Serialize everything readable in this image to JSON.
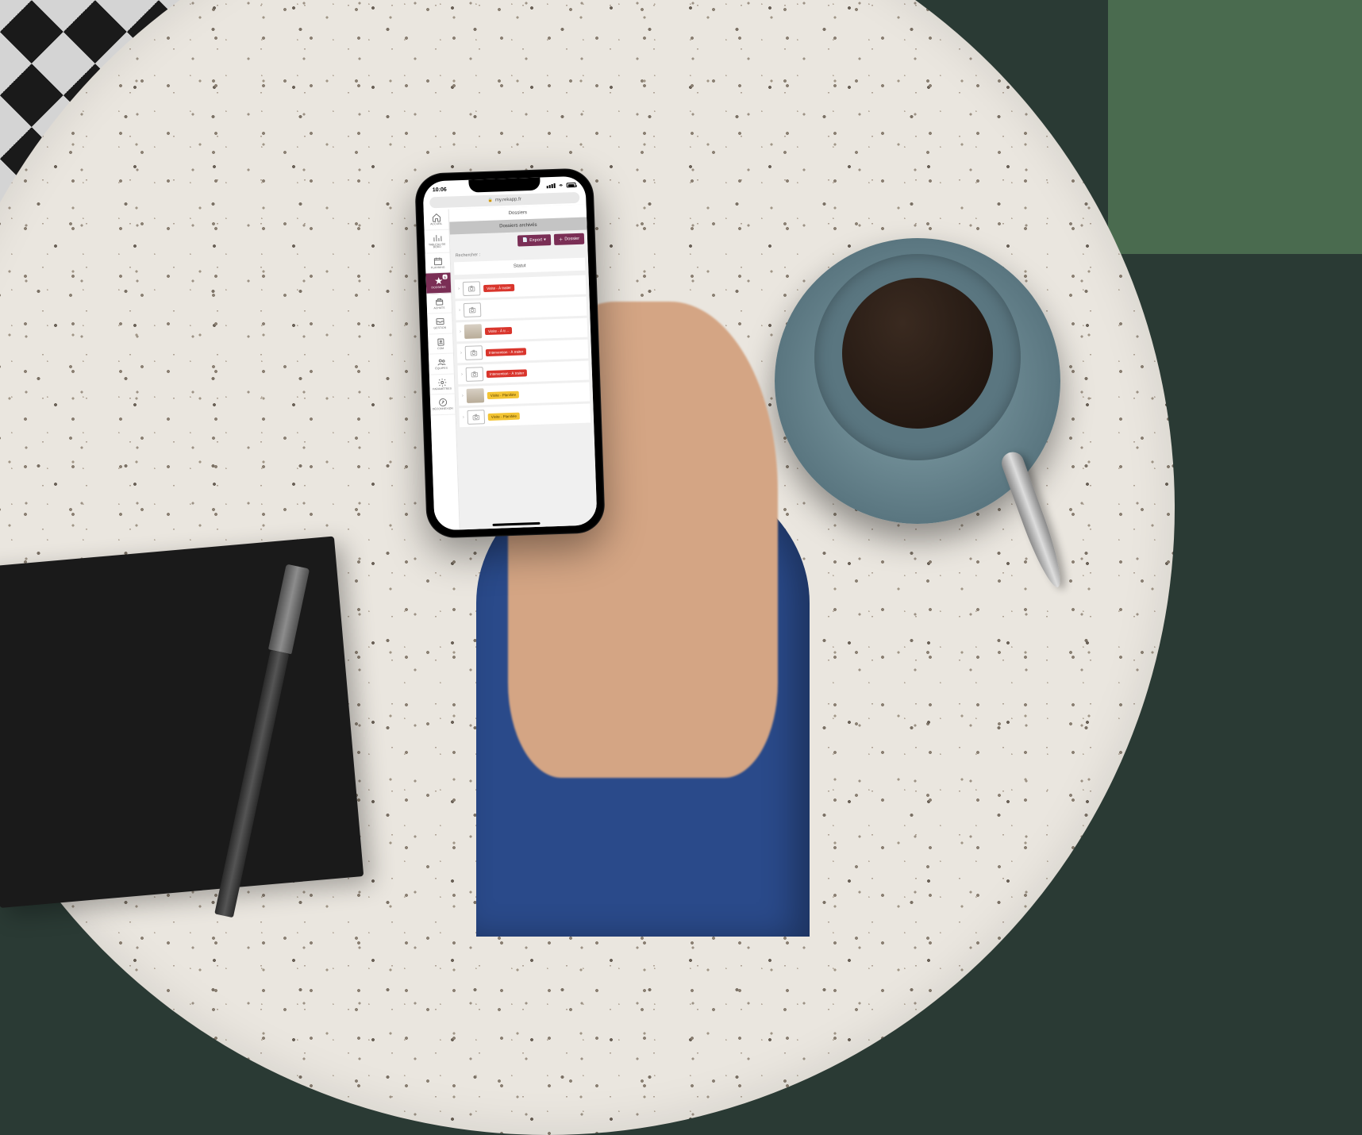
{
  "status_bar": {
    "time": "10:06"
  },
  "url": "my.rekapp.fr",
  "sidebar": {
    "badge": "5",
    "items": [
      {
        "label": "ACCUEIL"
      },
      {
        "label": "TABLEAU DE BORD"
      },
      {
        "label": "PLANNING"
      },
      {
        "label": "DOSSIERS"
      },
      {
        "label": "ACHATS"
      },
      {
        "label": "GESTION"
      },
      {
        "label": "COM"
      },
      {
        "label": "ÉQUIPES"
      },
      {
        "label": "PARAMÈTRES"
      },
      {
        "label": "DÉCONNEXION"
      }
    ]
  },
  "tabs": {
    "dossiers": "Dossiers",
    "archives": "Dossiers archivés"
  },
  "buttons": {
    "export": "Export",
    "dossier": "Dossier"
  },
  "search": {
    "label": "Rechercher :"
  },
  "column": {
    "statut": "Statut"
  },
  "rows": [
    {
      "status": "Visite - À traiter",
      "cls": "status-red",
      "thumb": "cam"
    },
    {
      "status": "",
      "cls": "",
      "thumb": "cam"
    },
    {
      "status": "Visite - À tr…",
      "cls": "status-red",
      "thumb": "photo"
    },
    {
      "status": "Intervention - À traiter",
      "cls": "status-red",
      "thumb": "cam"
    },
    {
      "status": "Intervention - À traiter",
      "cls": "status-red",
      "thumb": "cam"
    },
    {
      "status": "Visite - Planifiée",
      "cls": "status-yellow",
      "thumb": "photo"
    },
    {
      "status": "Visite - Planifiée",
      "cls": "status-yellow",
      "thumb": "cam"
    }
  ]
}
